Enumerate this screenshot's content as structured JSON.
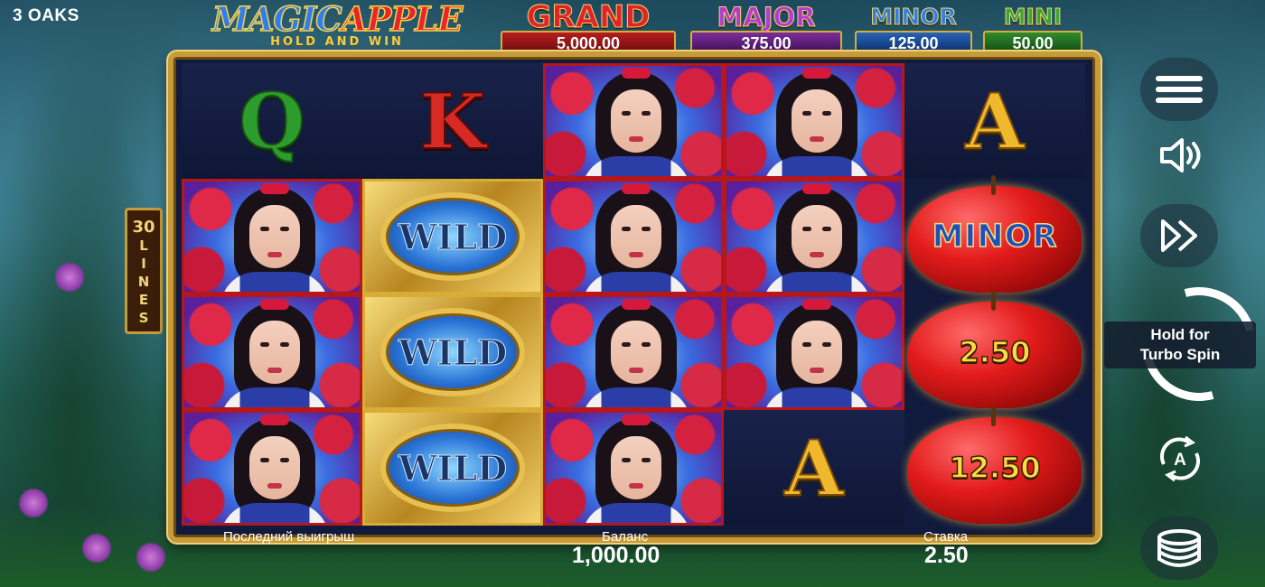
{
  "brand": "3 OAKS",
  "logo": {
    "word1": "MAGIC",
    "word2": "APPLE",
    "subtitle": "HOLD AND WIN"
  },
  "jackpots": {
    "grand": {
      "name": "GRAND",
      "amount": "5,000.00"
    },
    "major": {
      "name": "MAJOR",
      "amount": "375.00"
    },
    "minor": {
      "name": "MINOR",
      "amount": "125.00"
    },
    "mini": {
      "name": "MINI",
      "amount": "50.00"
    }
  },
  "lines": {
    "count": "30",
    "word": [
      "L",
      "I",
      "N",
      "E",
      "S"
    ]
  },
  "reels": {
    "r0c0": "Q",
    "r0c1": "K",
    "r0c4": "A",
    "r3c3": "A",
    "wild": "WILD",
    "apple_minor": "MINOR",
    "apple_value_1": "2.50",
    "apple_value_2": "12.50"
  },
  "stats": {
    "last_win_label": "Последний выигрыш",
    "balance_label": "Баланс",
    "balance_value": "1,000.00",
    "bet_label": "Ставка",
    "bet_value": "2.50"
  },
  "controls": {
    "spin_label_line1": "Hold for",
    "spin_label_line2": "Turbo Spin",
    "autoplay_letter": "A",
    "icons": [
      "menu-icon",
      "sound-icon",
      "fast-forward-icon",
      "spin-icon",
      "autoplay-icon",
      "coins-icon"
    ]
  },
  "colors": {
    "grand": "#e1232a",
    "major": "#b53ad4",
    "minor": "#2b7fe8",
    "mini": "#3aa43a",
    "frame_gold": "#c89b3a"
  }
}
